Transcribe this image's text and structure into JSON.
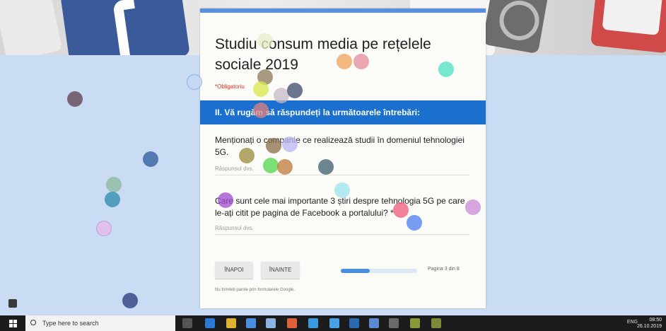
{
  "form": {
    "title": "Studiu consum media pe rețelele sociale 2019",
    "required_note": "*Obligatoriu",
    "section_title": "II. Vă rugăm să răspundeți la următoarele întrebări:",
    "questions": [
      {
        "text": "Menționați o companie ce realizează studii în domeniul tehnologiei 5G.",
        "placeholder": "Răspunsul dvs."
      },
      {
        "text": "Care sunt cele mai importante 3 știri despre tehnologia 5G pe care le-ați citit pe pagina de Facebook a portalului? *",
        "placeholder": "Răspunsul dvs."
      }
    ],
    "back_label": "ÎNAPOI",
    "next_label": "ÎNAINTE",
    "progress": 0.38,
    "page_label": "Pagina 3 din 8",
    "footnote": "Nu trimiteți parole prin formularele Google."
  },
  "taskbar": {
    "search_placeholder": "Type here to search",
    "tray_text": "ENG",
    "time": "08:50",
    "date": "26.10.2019"
  },
  "colors": {
    "section_blue": "#1a6fcf",
    "accent": "#4a8ee0",
    "required_red": "#d93025"
  }
}
